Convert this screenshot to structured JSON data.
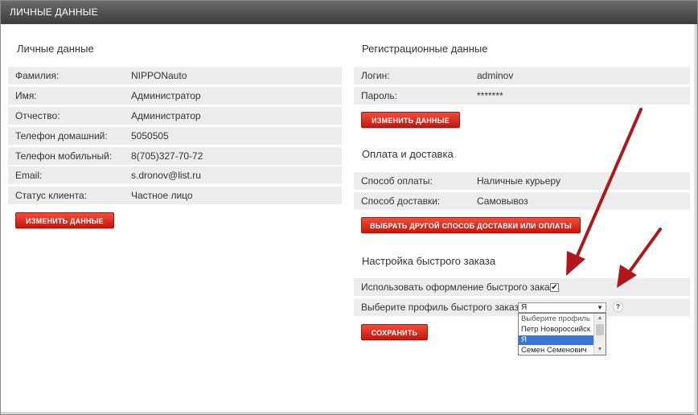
{
  "window": {
    "title": "ЛИЧНЫЕ ДАННЫЕ"
  },
  "personal": {
    "title": "Личные данные",
    "rows": [
      {
        "label": "Фамилия:",
        "value": "NIPPONauto"
      },
      {
        "label": "Имя:",
        "value": "Администратор"
      },
      {
        "label": "Отчество:",
        "value": "Администратор"
      },
      {
        "label": "Телефон домашний:",
        "value": "5050505"
      },
      {
        "label": "Телефон мобильный:",
        "value": "8(705)327-70-72"
      },
      {
        "label": "Email:",
        "value": "s.dronov@list.ru"
      },
      {
        "label": "Статус клиента:",
        "value": "Частное лицо"
      }
    ],
    "edit_button": "ИЗМЕНИТЬ ДАННЫЕ"
  },
  "registration": {
    "title": "Регистрационные данные",
    "rows": [
      {
        "label": "Логин:",
        "value": "adminov"
      },
      {
        "label": "Пароль:",
        "value": "*******"
      }
    ],
    "edit_button": "ИЗМЕНИТЬ ДАННЫЕ"
  },
  "payment": {
    "title": "Оплата и доставка",
    "rows": [
      {
        "label": "Способ оплаты:",
        "value": "Наличные курьеру"
      },
      {
        "label": "Способ доставки:",
        "value": "Самовывоз"
      }
    ],
    "change_button": "ВЫБРАТЬ ДРУГОЙ СПОСОБ ДОСТАВКИ ИЛИ ОПЛАТЫ"
  },
  "quick_order": {
    "title": "Настройка быстрого заказа",
    "use_label": "Использовать оформление быстрого заказа",
    "use_checked": true,
    "checkmark": "✔",
    "profile_label": "Выберите профиль быстрого заказа",
    "profile_selected": "Я",
    "profile_options": [
      "Выберите профиль",
      "Петр Новороссийск",
      "Я",
      "Семен Семенович"
    ],
    "help": "?",
    "save_button": "СОХРАНИТЬ"
  },
  "annotations": {
    "arrow_color": "#b0171c"
  }
}
